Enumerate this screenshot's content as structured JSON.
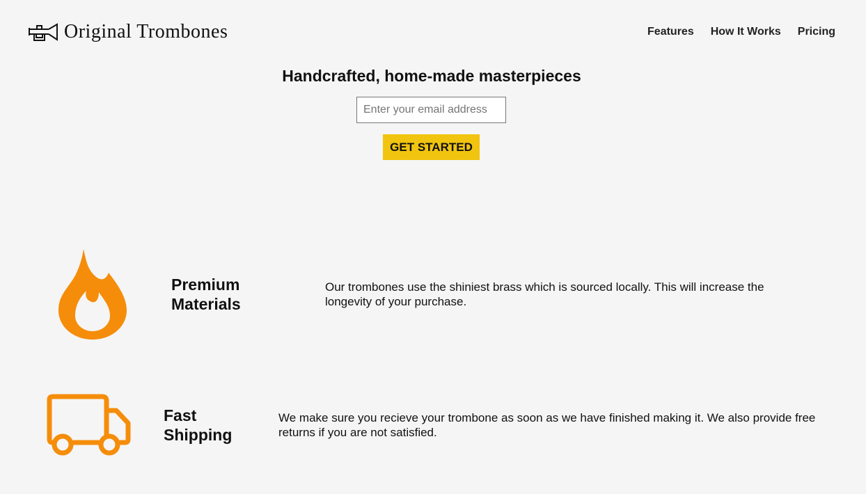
{
  "brand": {
    "name": "Original Trombones",
    "icon": "trombone-icon"
  },
  "nav": [
    {
      "label": "Features"
    },
    {
      "label": "How It Works"
    },
    {
      "label": "Pricing"
    }
  ],
  "hero": {
    "title": "Handcrafted, home-made masterpieces",
    "email_placeholder": "Enter your email address",
    "cta_label": "GET STARTED"
  },
  "colors": {
    "accent": "#f1c40f",
    "icon": "#f58d0a",
    "background": "#f5f5f5"
  },
  "features": [
    {
      "icon": "fire-icon",
      "title": "Premium Materials",
      "description": "Our trombones use the shiniest brass which is sourced locally. This will increase the longevity of your purchase."
    },
    {
      "icon": "truck-icon",
      "title": "Fast Shipping",
      "description": "We make sure you recieve your trombone as soon as we have finished making it. We also provide free returns if you are not satisfied."
    }
  ]
}
